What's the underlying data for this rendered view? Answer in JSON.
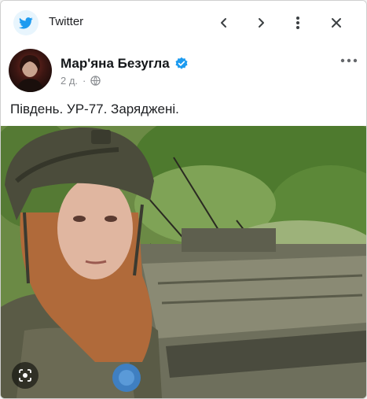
{
  "app": {
    "title": "Twitter",
    "icon": "twitter-bird-icon",
    "brand_color": "#1d9bf0"
  },
  "toolbar": {
    "back_icon": "chevron-left-icon",
    "forward_icon": "chevron-right-icon",
    "menu_icon": "vertical-dots-icon",
    "close_icon": "close-icon"
  },
  "tweet": {
    "author_name": "Мар'яна Безугла",
    "verified_color": "#1d9bf0",
    "time": "2 д.",
    "separator": "·",
    "audience_icon": "globe-icon",
    "text": "Південь. УР-77. Заряджені."
  },
  "image": {
    "lens_icon": "google-lens-icon"
  }
}
